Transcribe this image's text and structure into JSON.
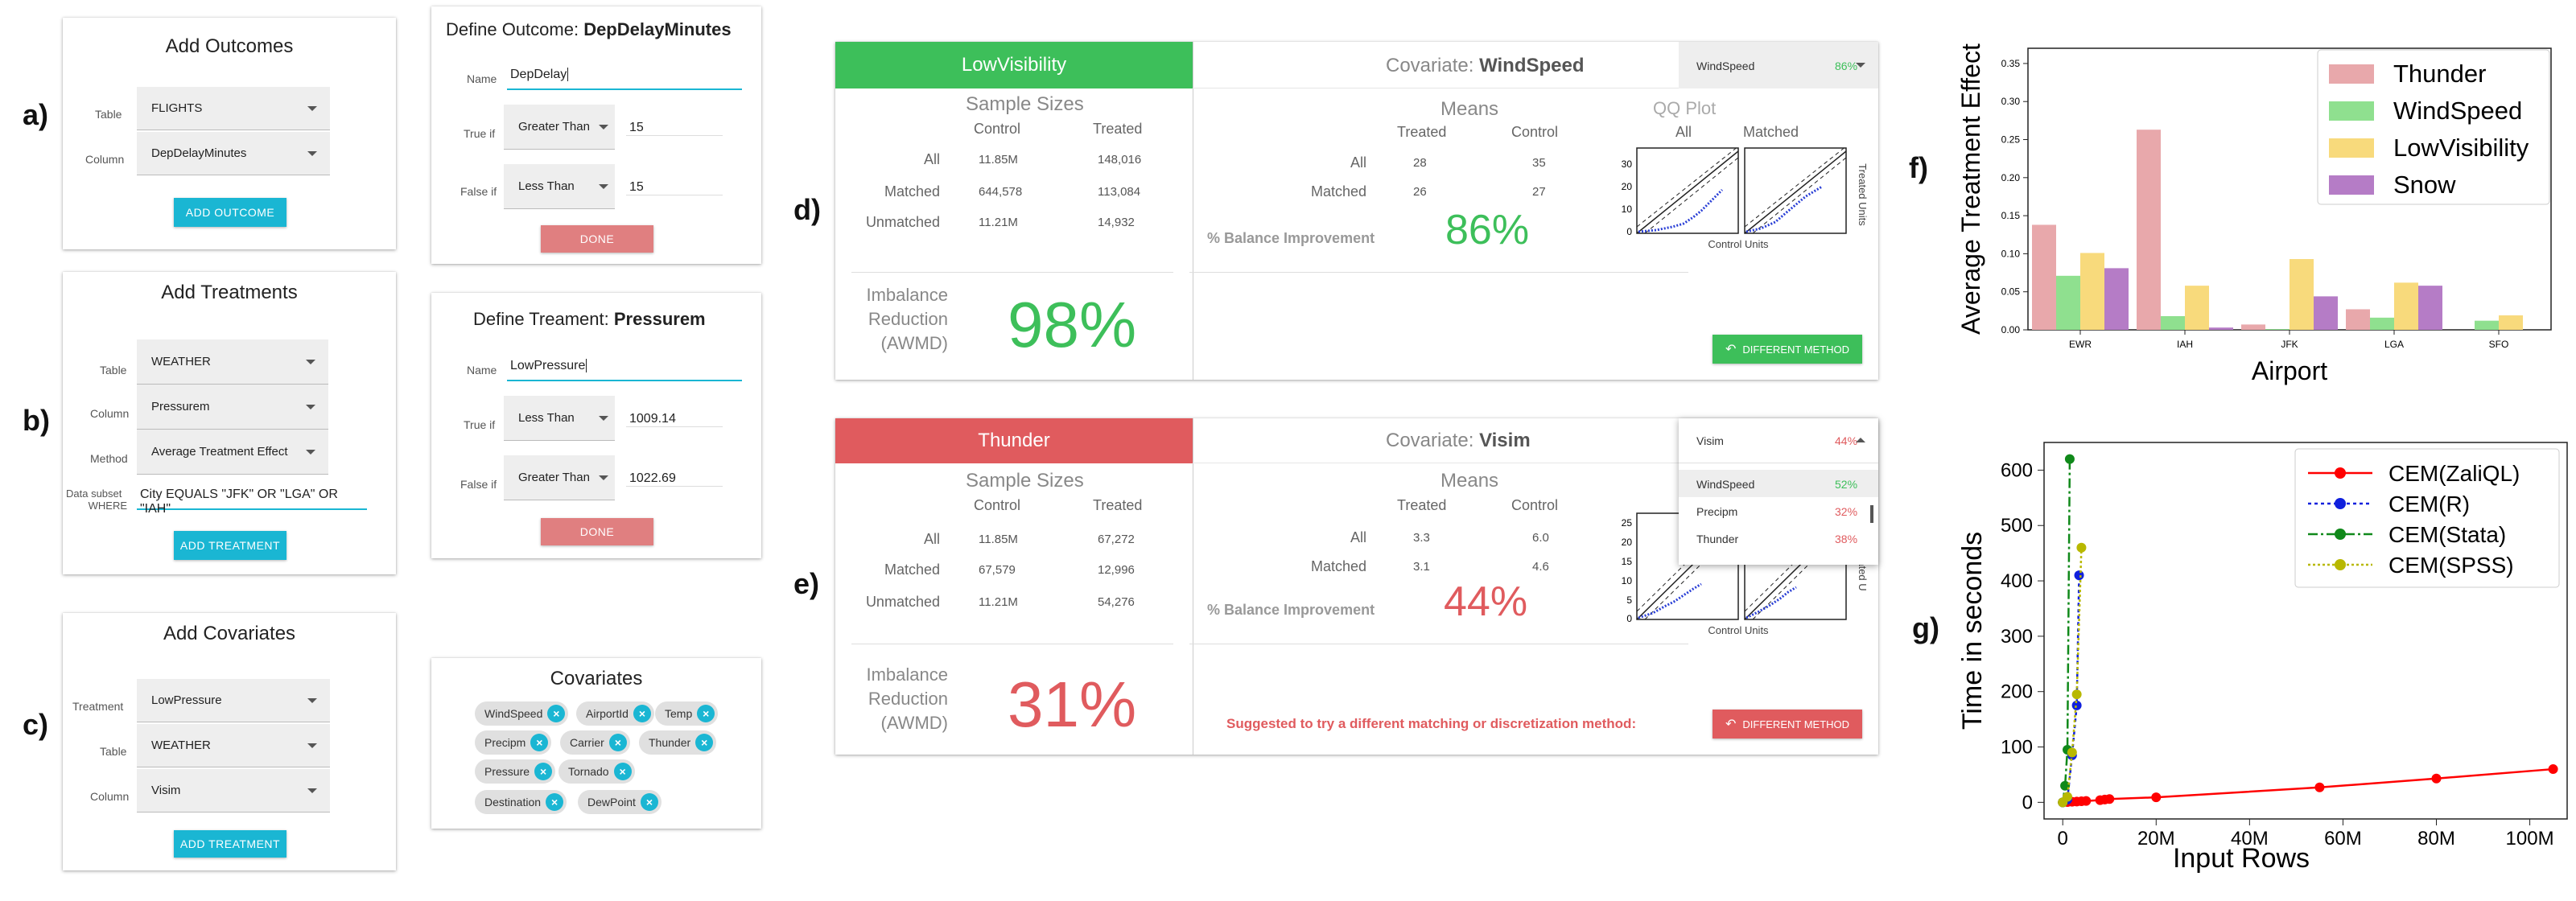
{
  "labels": {
    "a": "a)",
    "b": "b)",
    "c": "c)",
    "d": "d)",
    "e": "e)",
    "f": "f)",
    "g": "g)"
  },
  "add_outcomes": {
    "title": "Add Outcomes",
    "table_label": "Table",
    "table_value": "FLIGHTS",
    "column_label": "Column",
    "column_value": "DepDelayMinutes",
    "button": "ADD OUTCOME"
  },
  "define_outcome": {
    "title_prefix": "Define Outcome: ",
    "title_name": "DepDelayMinutes",
    "name_label": "Name",
    "name_value": "DepDelay",
    "true_label": "True if",
    "true_op": "Greater Than",
    "true_val": "15",
    "false_label": "False if",
    "false_op": "Less Than",
    "false_val": "15",
    "button": "DONE"
  },
  "add_treatments": {
    "title": "Add Treatments",
    "table_label": "Table",
    "table_value": "WEATHER",
    "column_label": "Column",
    "column_value": "Pressurem",
    "method_label": "Method",
    "method_value": "Average Treatment Effect",
    "subset_label1": "Data subset",
    "subset_label2": "WHERE",
    "subset_value": "City EQUALS \"JFK\" OR \"LGA\" OR \"IAH\"",
    "button": "ADD TREATMENT"
  },
  "define_treatment": {
    "title_prefix": "Define Treament: ",
    "title_name": "Pressurem",
    "name_label": "Name",
    "name_value": "LowPressure",
    "true_label": "True if",
    "true_op": "Less Than",
    "true_val": "1009.14",
    "false_label": "False if",
    "false_op": "Greater Than",
    "false_val": "1022.69",
    "button": "DONE"
  },
  "add_covariates": {
    "title": "Add Covariates",
    "treatment_label": "Treatment",
    "treatment_value": "LowPressure",
    "table_label": "Table",
    "table_value": "WEATHER",
    "column_label": "Column",
    "column_value": "Visim",
    "button": "ADD TREATMENT"
  },
  "covariates": {
    "title": "Covariates",
    "chips": [
      "WindSpeed",
      "AirportId",
      "Temp",
      "Precipm",
      "Carrier",
      "Thunder",
      "Pressure",
      "Tornado",
      "Destination",
      "DewPoint"
    ]
  },
  "panel_d": {
    "header": "LowVisibility",
    "sample_sizes": "Sample Sizes",
    "control": "Control",
    "treated": "Treated",
    "rows": [
      {
        "label": "All",
        "control": "11.85M",
        "treated": "148,016"
      },
      {
        "label": "Matched",
        "control": "644,578",
        "treated": "113,084"
      },
      {
        "label": "Unmatched",
        "control": "11.21M",
        "treated": "14,932"
      }
    ],
    "imbalance1": "Imbalance",
    "imbalance2": "Reduction",
    "imbalance3": "(AWMD)",
    "imbalance_value": "98%",
    "covariate_prefix": "Covariate: ",
    "covariate_name": "WindSpeed",
    "dropdown_name": "WindSpeed",
    "dropdown_pct": "86%",
    "means": "Means",
    "means_treated": "Treated",
    "means_control": "Control",
    "means_rows": [
      {
        "label": "All",
        "treated": "28",
        "control": "35"
      },
      {
        "label": "Matched",
        "treated": "26",
        "control": "27"
      }
    ],
    "balance_label": "% Balance Improvement",
    "balance_value": "86%",
    "qq_title": "QQ Plot",
    "qq_all": "All",
    "qq_matched": "Matched",
    "qq_xlabel": "Control Units",
    "qq_ylabel": "Treated Units",
    "qq_ticks": [
      "0",
      "10",
      "20",
      "30"
    ],
    "button": "DIFFERENT METHOD"
  },
  "panel_e": {
    "header": "Thunder",
    "sample_sizes": "Sample Sizes",
    "control": "Control",
    "treated": "Treated",
    "rows": [
      {
        "label": "All",
        "control": "11.85M",
        "treated": "67,272"
      },
      {
        "label": "Matched",
        "control": "67,579",
        "treated": "12,996"
      },
      {
        "label": "Unmatched",
        "control": "11.21M",
        "treated": "54,276"
      }
    ],
    "imbalance1": "Imbalance",
    "imbalance2": "Reduction",
    "imbalance3": "(AWMD)",
    "imbalance_value": "31%",
    "covariate_prefix": "Covariate: ",
    "covariate_name": "Visim",
    "dropdown_name": "Visim",
    "dropdown_pct": "44%",
    "dropdown_options": [
      {
        "name": "WindSpeed",
        "pct": "52%"
      },
      {
        "name": "Precipm",
        "pct": "32%"
      },
      {
        "name": "Thunder",
        "pct": "38%"
      }
    ],
    "means": "Means",
    "means_treated": "Treated",
    "means_control": "Control",
    "means_rows": [
      {
        "label": "All",
        "treated": "3.3",
        "control": "6.0"
      },
      {
        "label": "Matched",
        "treated": "3.1",
        "control": "4.6"
      }
    ],
    "balance_label": "% Balance Improvement",
    "balance_value": "44%",
    "qq_xlabel": "Control Units",
    "qq_ylabel": "Treated U",
    "qq_ticks": [
      "0",
      "5",
      "10",
      "15",
      "20",
      "25"
    ],
    "qq_title_partial": "A",
    "suggestion": "Suggested to try a different matching or discretization method:",
    "button": "DIFFERENT METHOD"
  },
  "colors": {
    "green": "#3dbf5a",
    "red": "#e05b5e",
    "cyan": "#1ab6d3",
    "thunder": "#e8a8ab",
    "windspeed": "#8fe08f",
    "lowvis": "#f8da7c",
    "snow": "#b57cc6"
  },
  "chart_data": [
    {
      "type": "bar",
      "title": "",
      "xlabel": "Airport",
      "ylabel": "Average Treatment Effect",
      "categories": [
        "EWR",
        "IAH",
        "JFK",
        "LGA",
        "SFO"
      ],
      "ylim": [
        0,
        0.37
      ],
      "yticks": [
        "0.00",
        "0.05",
        "0.10",
        "0.15",
        "0.20",
        "0.25",
        "0.30",
        "0.35"
      ],
      "legend_position": "top-right",
      "series": [
        {
          "name": "Thunder",
          "values": [
            0.138,
            0.263,
            0.007,
            0.027,
            0.0
          ]
        },
        {
          "name": "WindSpeed",
          "values": [
            0.071,
            0.018,
            0.001,
            0.016,
            0.012
          ]
        },
        {
          "name": "LowVisibility",
          "values": [
            0.101,
            0.058,
            0.093,
            0.062,
            0.019
          ]
        },
        {
          "name": "Snow",
          "values": [
            0.081,
            0.003,
            0.044,
            0.058,
            0.0
          ]
        }
      ]
    },
    {
      "type": "line",
      "title": "",
      "xlabel": "Input Rows",
      "ylabel": "Time in seconds",
      "xlim": [
        -4,
        108
      ],
      "ylim": [
        -30,
        650
      ],
      "xticks": [
        "0",
        "20M",
        "40M",
        "60M",
        "80M",
        "100M"
      ],
      "xtick_values": [
        0,
        20,
        40,
        60,
        80,
        100
      ],
      "yticks": [
        "0",
        "100",
        "200",
        "300",
        "400",
        "500",
        "600"
      ],
      "ytick_values": [
        0,
        100,
        200,
        300,
        400,
        500,
        600
      ],
      "legend_position": "top-right",
      "series": [
        {
          "name": "CEM(ZaliQL)",
          "x": [
            0,
            1,
            2,
            3,
            4,
            5,
            8,
            9,
            10,
            20,
            55,
            80,
            105
          ],
          "y": [
            0,
            0.5,
            1,
            1.5,
            2,
            2.5,
            4,
            5,
            6,
            9,
            27,
            43,
            60
          ]
        },
        {
          "name": "CEM(R)",
          "x": [
            0,
            1,
            2,
            3,
            3.5
          ],
          "y": [
            0,
            5,
            85,
            175,
            410
          ]
        },
        {
          "name": "CEM(Stata)",
          "x": [
            0,
            0.5,
            1,
            1.5
          ],
          "y": [
            0,
            30,
            95,
            620
          ]
        },
        {
          "name": "CEM(SPSS)",
          "x": [
            0,
            1,
            2,
            3,
            4
          ],
          "y": [
            0,
            10,
            90,
            195,
            460
          ]
        }
      ]
    }
  ]
}
